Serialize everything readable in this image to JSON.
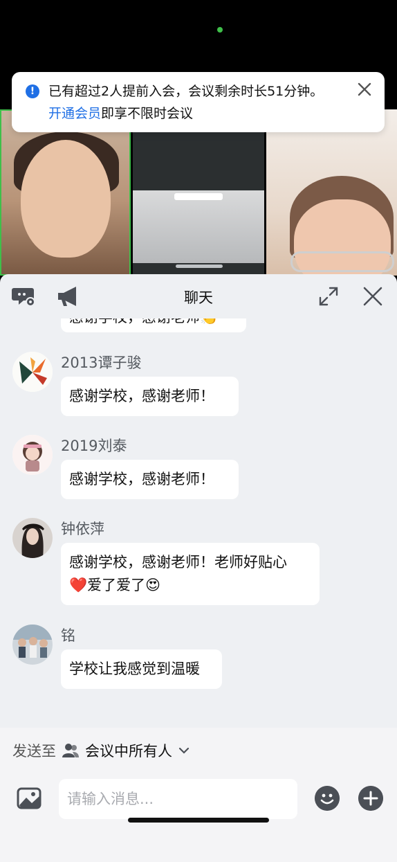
{
  "notice": {
    "line1": "已有超过2人提前入会，会议剩余时长51分钟。",
    "vip_link": "开通会员",
    "line2_rest": "即享不限时会议"
  },
  "header": {
    "title": "聊天"
  },
  "messages": [
    {
      "sender": "",
      "text": "感谢学校，感谢老师👏",
      "partial": true
    },
    {
      "sender": "2013谭子骏",
      "text": "感谢学校，感谢老师！"
    },
    {
      "sender": "2019刘泰",
      "text": "感谢学校，感谢老师！"
    },
    {
      "sender": "钟依萍",
      "text_line1": "感谢学校，感谢老师！老师好贴心",
      "text_line2": "❤️爱了爱了😍"
    },
    {
      "sender": "铭",
      "text": "学校让我感觉到温暖"
    }
  ],
  "composer": {
    "send_to_label": "发送至",
    "send_to_target": "会议中所有人",
    "placeholder": "请输入消息..."
  },
  "colors": {
    "accent": "#1f6fe5",
    "online": "#3fbf4a",
    "panel_bg": "#eef0f3"
  }
}
